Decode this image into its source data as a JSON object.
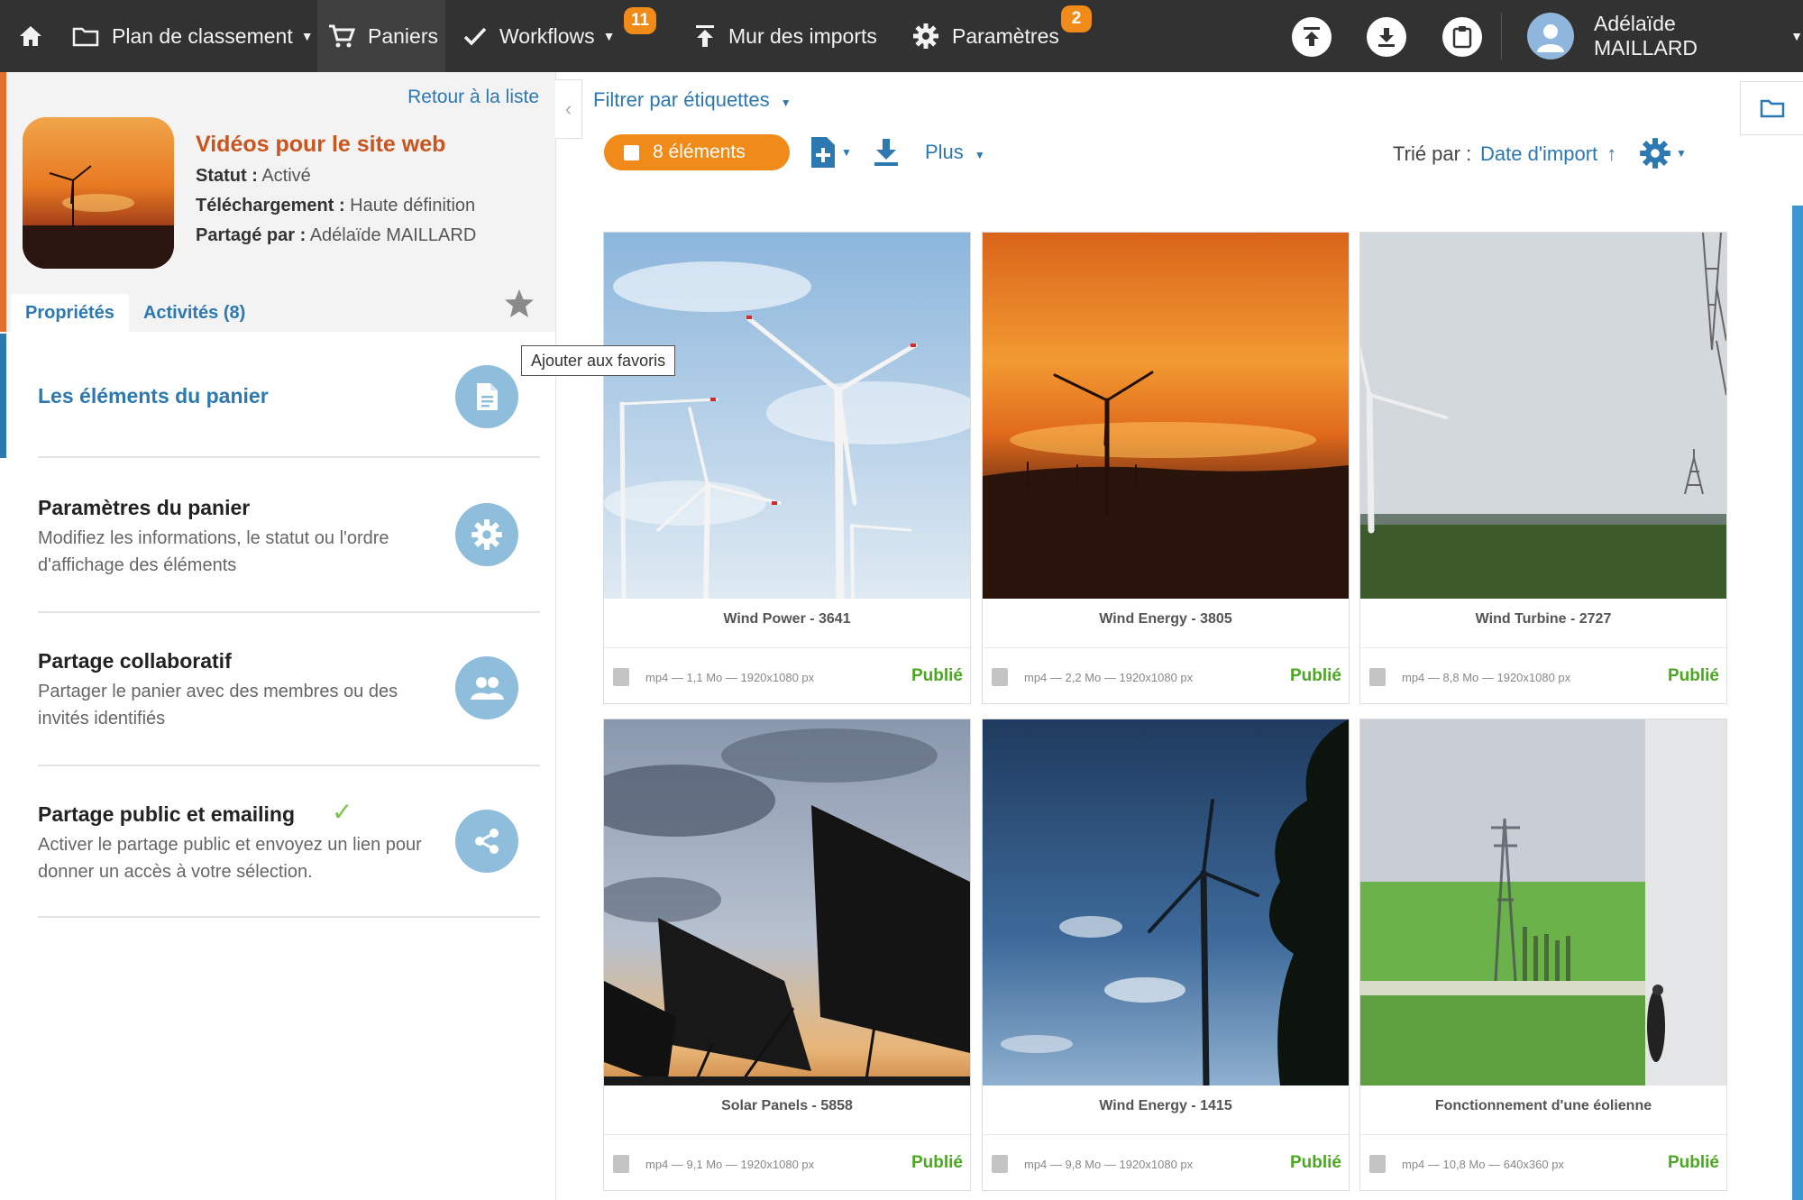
{
  "nav": {
    "plan": "Plan de classement",
    "paniers": "Paniers",
    "workflows": "Workflows",
    "workflows_badge": "11",
    "imports": "Mur des imports",
    "params": "Paramètres",
    "params_badge": "2",
    "user": "Adélaïde MAILLARD"
  },
  "basket": {
    "back": "Retour à la liste",
    "title": "Vidéos pour le site web",
    "status_label": "Statut :",
    "status_value": "Activé",
    "download_label": "Téléchargement :",
    "download_value": "Haute définition",
    "shared_label": "Partagé par :",
    "shared_value": "Adélaïde MAILLARD",
    "tab_props": "Propriétés",
    "tab_activities": "Activités (8)",
    "tooltip": "Ajouter aux favoris"
  },
  "menu": {
    "items_title": "Les éléments du panier",
    "settings_title": "Paramètres du panier",
    "settings_desc": "Modifiez les informations, le statut ou l'ordre d'affichage des éléments",
    "collab_title": "Partage collaboratif",
    "collab_desc": "Partager le panier avec des membres ou des invités identifiés",
    "public_title": "Partage public et emailing",
    "public_desc": "Activer le partage public et envoyez un lien pour donner un accès à votre sélection."
  },
  "toolbar": {
    "filter": "Filtrer par étiquettes",
    "count": "8 éléments",
    "more": "Plus",
    "sort_label": "Trié par :",
    "sort_value": "Date d'import"
  },
  "cards": [
    {
      "title": "Wind Power - 3641",
      "meta": "mp4 — 1,1 Mo — 1920x1080 px",
      "status": "Publié"
    },
    {
      "title": "Wind Energy - 3805",
      "meta": "mp4 — 2,2 Mo — 1920x1080 px",
      "status": "Publié"
    },
    {
      "title": "Wind Turbine - 2727",
      "meta": "mp4 — 8,8 Mo — 1920x1080 px",
      "status": "Publié"
    },
    {
      "title": "Solar Panels - 5858",
      "meta": "mp4 — 9,1 Mo — 1920x1080 px",
      "status": "Publié"
    },
    {
      "title": "Wind Energy - 1415",
      "meta": "mp4 — 9,8 Mo — 1920x1080 px",
      "status": "Publié"
    },
    {
      "title": "Fonctionnement d'une éolienne",
      "meta": "mp4 — 10,8 Mo — 640x360 px",
      "status": "Publié"
    }
  ],
  "colors": {
    "topbar": "#323232",
    "accent_orange": "#f08a18",
    "link_blue": "#2c78b0",
    "status_green": "#4aa820",
    "icon_circle": "#8fbedd"
  }
}
